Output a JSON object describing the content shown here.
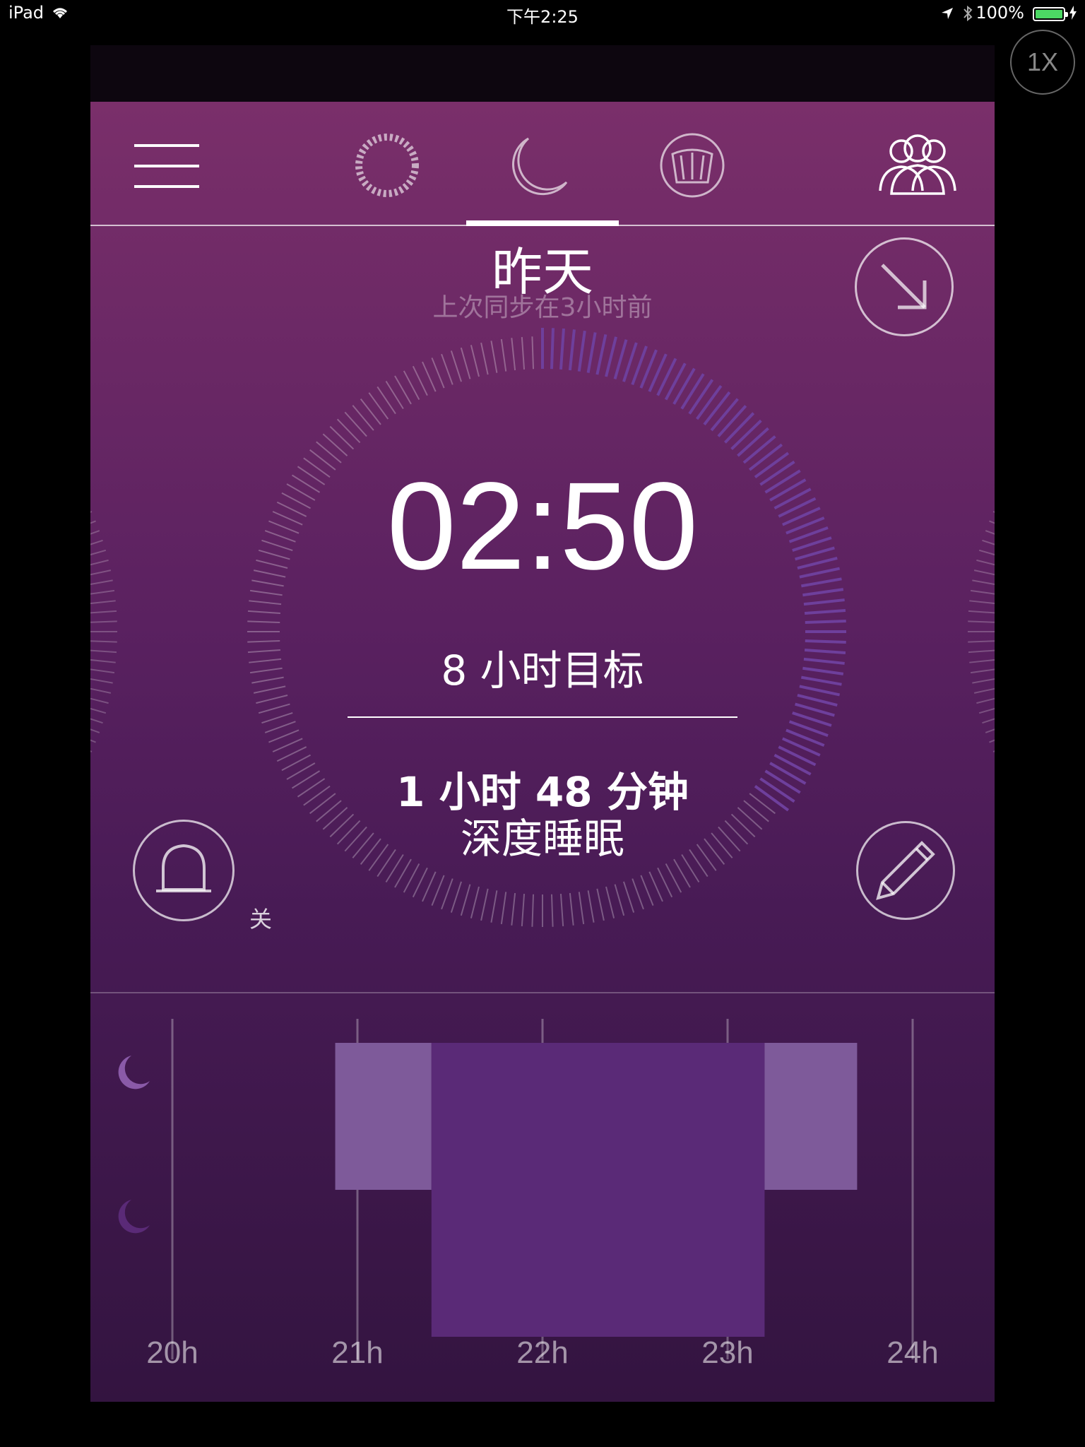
{
  "status_bar": {
    "device": "iPad",
    "time": "下午2:25",
    "battery": "100%"
  },
  "zoom_button": "1X",
  "nav": {
    "tabs": [
      {
        "name": "activity",
        "icon": "dotted-ring-icon",
        "active": false
      },
      {
        "name": "sleep",
        "icon": "moon-icon",
        "active": true
      },
      {
        "name": "scale",
        "icon": "scale-icon",
        "active": false
      }
    ],
    "menu_icon": "hamburger-icon",
    "friends_icon": "people-icon"
  },
  "header": {
    "title": "昨天",
    "sync_status": "上次同步在3小时前"
  },
  "sleep_summary": {
    "duration": "02:50",
    "goal": "8 小时目标",
    "goal_progress": 0.354,
    "deep_sleep_duration": "1 小时 48 分钟",
    "deep_sleep_label": "深度睡眠"
  },
  "alarm": {
    "icon": "bell-icon",
    "state": "关"
  },
  "edit_icon": "pencil-icon",
  "expand_icon": "arrow-down-right-icon",
  "colors": {
    "accent": "#7b2d6b",
    "light_sleep": "#7e5a9a",
    "deep_sleep": "#5a2a77",
    "progress": "#6e3f9c"
  },
  "chart_data": {
    "type": "bar",
    "x_tick_labels": [
      "20h",
      "21h",
      "22h",
      "23h",
      "24h"
    ],
    "xlim": [
      20,
      24
    ],
    "levels": [
      "light",
      "deep"
    ],
    "segments": [
      {
        "start": 20.88,
        "end": 21.4,
        "level": "light"
      },
      {
        "start": 21.4,
        "end": 23.2,
        "level": "deep"
      },
      {
        "start": 23.2,
        "end": 23.7,
        "level": "light"
      }
    ]
  }
}
